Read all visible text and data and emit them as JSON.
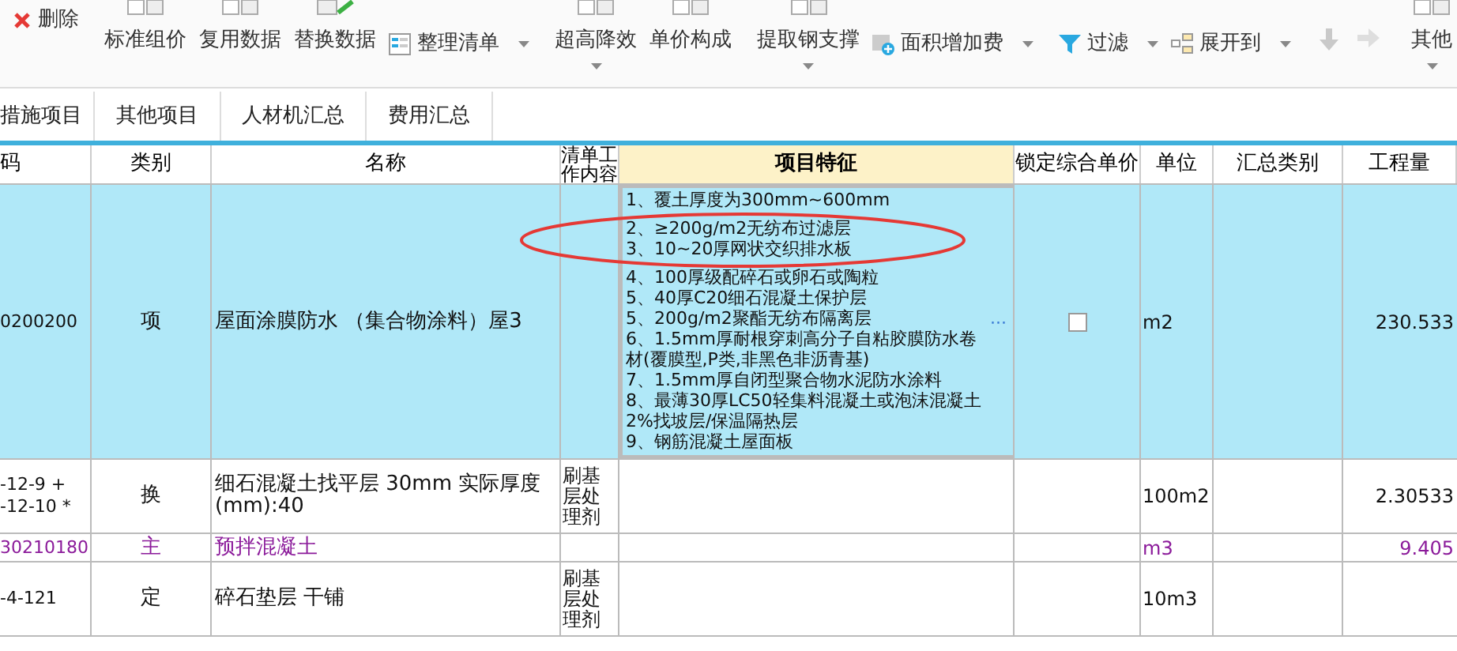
{
  "toolbar": {
    "items": [
      {
        "label": "删除",
        "kind": "delete",
        "caret": false,
        "disabled": false
      },
      {
        "label": "标准组价",
        "kind": "doc",
        "caret": false,
        "disabled": false
      },
      {
        "label": "复用数据",
        "kind": "doc",
        "caret": false,
        "disabled": false
      },
      {
        "label": "替换数据",
        "kind": "grid",
        "caret": false,
        "disabled": false
      },
      {
        "label": "整理清单",
        "kind": "list",
        "caret": true,
        "disabled": false
      },
      {
        "label": "超高降效",
        "kind": "doc",
        "caret": true,
        "disabled": false
      },
      {
        "label": "单价构成",
        "kind": "doc",
        "caret": false,
        "disabled": false
      },
      {
        "label": "提取钢支撑",
        "kind": "doc",
        "caret": true,
        "disabled": false
      },
      {
        "label": "面积增加费",
        "kind": "area",
        "caret": true,
        "disabled": false
      },
      {
        "label": "过滤",
        "kind": "filter",
        "caret": true,
        "disabled": false
      },
      {
        "label": "展开到",
        "kind": "tree",
        "caret": true,
        "disabled": false
      },
      {
        "kind": "down",
        "caret": false,
        "disabled": true
      },
      {
        "kind": "right",
        "caret": false,
        "disabled": true
      },
      {
        "label": "其他",
        "kind": "doc",
        "caret": true,
        "disabled": false
      }
    ]
  },
  "tabs": [
    {
      "label": "措施项目"
    },
    {
      "label": "其他项目"
    },
    {
      "label": "人材机汇总"
    },
    {
      "label": "费用汇总"
    }
  ],
  "table": {
    "columns": [
      "码",
      "类别",
      "名称",
      "清单工作内容",
      "项目特征",
      "锁定综合单价",
      "单位",
      "汇总类别",
      "工程量"
    ],
    "rows": [
      {
        "kind": "item",
        "selected": true,
        "code": [
          "0200200"
        ],
        "type": "项",
        "name": "屋面涂膜防水 （集合物涂料）屋3",
        "features": [
          "1、覆土厚度为300mm~600mm",
          "2、≥200g/m2无纺布过滤层",
          "3、10~20厚网状交织排水板",
          "4、100厚级配碎石或卵石或陶粒",
          "5、40厚C20细石混凝土保护层",
          "5、200g/m2聚酯无纺布隔离层",
          "6、1.5mm厚耐根穿刺高分子自粘胶膜防水卷材(覆膜型,P类,非黑色非沥青基)",
          "7、1.5mm厚自闭型聚合物水泥防水涂料",
          "8、最薄30厚LC50轻集料混凝土或泡沫混凝土2%找坡层/保温隔热层",
          "9、钢筋混凝土屋面板"
        ],
        "more": "···",
        "lock": {
          "checked": false
        },
        "unit": "m2",
        "quantity": "230.533"
      },
      {
        "kind": "sub",
        "selected": false,
        "code": [
          "-12-9 +",
          "-12-10 *"
        ],
        "type": "换",
        "name": "细石混凝土找平层 30mm  实际厚度(mm):40",
        "work_content": "刷基层处理剂",
        "unit": "100m2",
        "quantity": "2.30533"
      },
      {
        "kind": "main",
        "selected": false,
        "code": [
          "30210180"
        ],
        "type": "主",
        "name": "预拌混凝土",
        "unit": "m3",
        "quantity": "9.405"
      },
      {
        "kind": "sub",
        "selected": false,
        "code": [
          "-4-121"
        ],
        "type": "定",
        "name": "碎石垫层 干铺",
        "work_content": "刷基层处理剂",
        "unit": "10m3"
      }
    ]
  },
  "annotation": {
    "color": "#e53935"
  }
}
